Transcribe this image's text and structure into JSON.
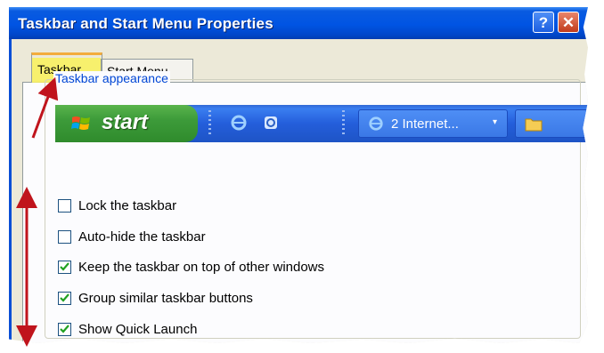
{
  "window": {
    "title": "Taskbar and Start Menu Properties",
    "help_label": "?",
    "close_label": "✕"
  },
  "tabs": [
    {
      "label": "Taskbar",
      "selected": true
    },
    {
      "label": "Start Menu",
      "selected": false
    }
  ],
  "group": {
    "label": "Taskbar appearance"
  },
  "preview": {
    "start_label": "start",
    "task_button_label": "2 Internet...",
    "icons": [
      "windows-flag-icon",
      "internet-explorer-icon",
      "outlook-express-icon",
      "internet-explorer-icon",
      "folder-icon"
    ]
  },
  "options": [
    {
      "label": "Lock the taskbar",
      "checked": false
    },
    {
      "label": "Auto-hide the taskbar",
      "checked": false
    },
    {
      "label": "Keep the taskbar on top of other windows",
      "checked": true
    },
    {
      "label": "Group similar taskbar buttons",
      "checked": true
    },
    {
      "label": "Show Quick Launch",
      "checked": true
    }
  ],
  "colors": {
    "titlebar": "#0054e3",
    "tab_highlight": "#f9f15a",
    "annotation_arrow": "#c0141c",
    "start_button": "#3d9b3a",
    "check": "#21a121"
  }
}
